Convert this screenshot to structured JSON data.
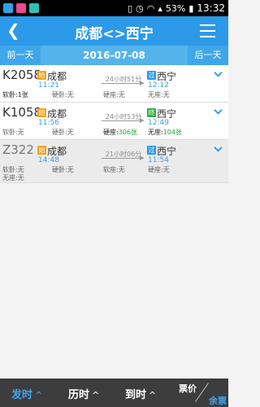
{
  "status": {
    "battery": "53%",
    "time": "13:32"
  },
  "header": {
    "title": "成都<>西宁"
  },
  "datebar": {
    "prev": "前一天",
    "date": "2016-07-08",
    "next": "后一天"
  },
  "trains": [
    {
      "no": "K2058",
      "from_badge": "始",
      "from": "成都",
      "depart": "11:21",
      "duration": "24小时51分",
      "to_badge": "过",
      "to": "西宁",
      "arrive": "12:12",
      "seat1": "软卧:1张",
      "seat2": "硬卧:无",
      "seat3": "硬座:无",
      "seat4": "无座:无"
    },
    {
      "no": "K1058",
      "from_badge": "始",
      "from": "成都",
      "depart": "11:56",
      "duration": "24小时53分",
      "to_badge": "终",
      "to": "西宁",
      "arrive": "12:49",
      "seat1": "软卧:无",
      "seat2": "硬卧:无",
      "seat3_label": "硬座:",
      "seat3_num": "306张",
      "seat4_label": "无座:",
      "seat4_num": "104张"
    },
    {
      "no": "Z322",
      "from_badge": "始",
      "from": "成都",
      "depart": "14:48",
      "duration": "21小时06分",
      "to_badge": "过",
      "to": "西宁",
      "arrive": "11:54",
      "seat1": "软卧:无",
      "seat2": "硬卧:无",
      "seat3": "软座:无",
      "seat4": "硬座:无",
      "seat5": "无座:无"
    }
  ],
  "bottom": {
    "tab1": "发时",
    "tab2": "历时",
    "tab3": "到时",
    "up": "^",
    "price": "票价",
    "remaining": "余票"
  },
  "colors": {
    "primary": "#2c9ae8",
    "start_badge": "#f3a11b",
    "end_badge": "#33b046",
    "available": "#22a33a"
  }
}
